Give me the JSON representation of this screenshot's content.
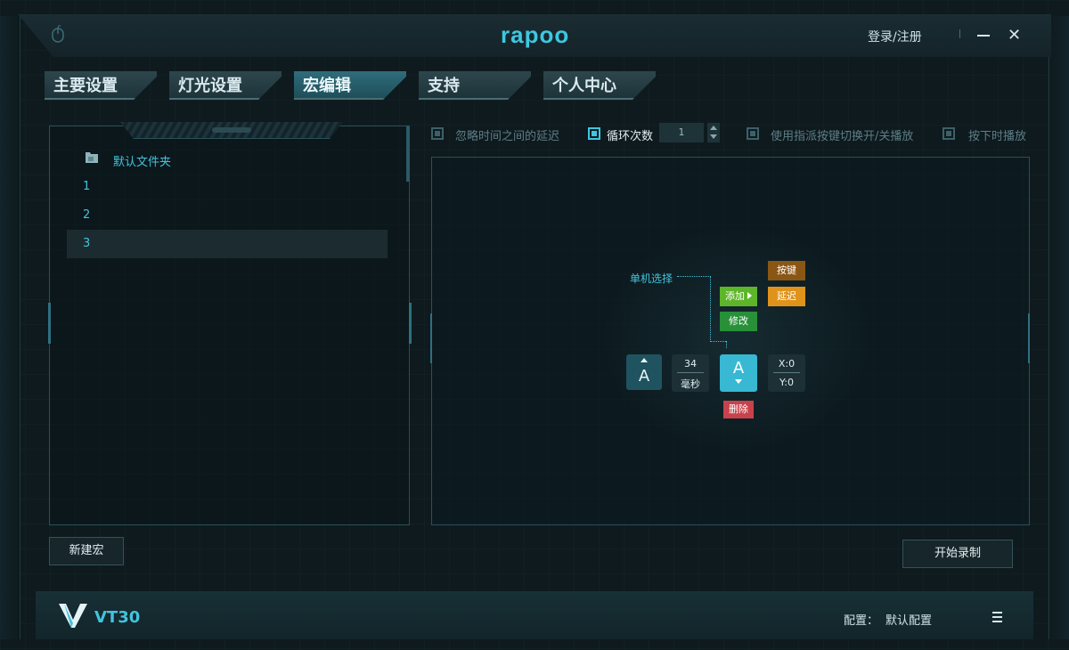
{
  "app": {
    "logo": "rapoo",
    "login": "登录/注册"
  },
  "tabs": [
    {
      "label": "主要设置",
      "active": false
    },
    {
      "label": "灯光设置",
      "active": false
    },
    {
      "label": "宏编辑",
      "active": true
    },
    {
      "label": "支持",
      "active": false
    },
    {
      "label": "个人中心",
      "active": false
    }
  ],
  "macro_list": {
    "folder": "默认文件夹",
    "items": [
      "1",
      "2",
      "3"
    ],
    "selected": "3",
    "new_button": "新建宏"
  },
  "options": {
    "ignore_delay": {
      "label": "忽略时间之间的延迟",
      "checked": false
    },
    "loop_count": {
      "label": "循环次数",
      "checked": true,
      "value": "1"
    },
    "toggle_key": {
      "label": "使用指派按键切换开/关播放",
      "checked": false
    },
    "hold_play": {
      "label": "按下时播放",
      "checked": false
    }
  },
  "editor": {
    "annotation": "单机选择",
    "add_button": "添加",
    "modify_button": "修改",
    "key_button": "按键",
    "delay_button": "延迟",
    "delete_button": "删除",
    "event1_key": "A",
    "delay_value": "34",
    "delay_unit": "毫秒",
    "event2_key": "A",
    "x_label": "X:0",
    "y_label": "Y:0"
  },
  "record_button": "开始录制",
  "footer": {
    "model": "VT30",
    "config_label": "配置：",
    "config_value": "默认配置"
  },
  "colors": {
    "accent": "#3ec7e0",
    "add": "#5db52a",
    "modify": "#279038",
    "key": "#8a5614",
    "delay": "#e0931b",
    "delete": "#c7424b"
  }
}
